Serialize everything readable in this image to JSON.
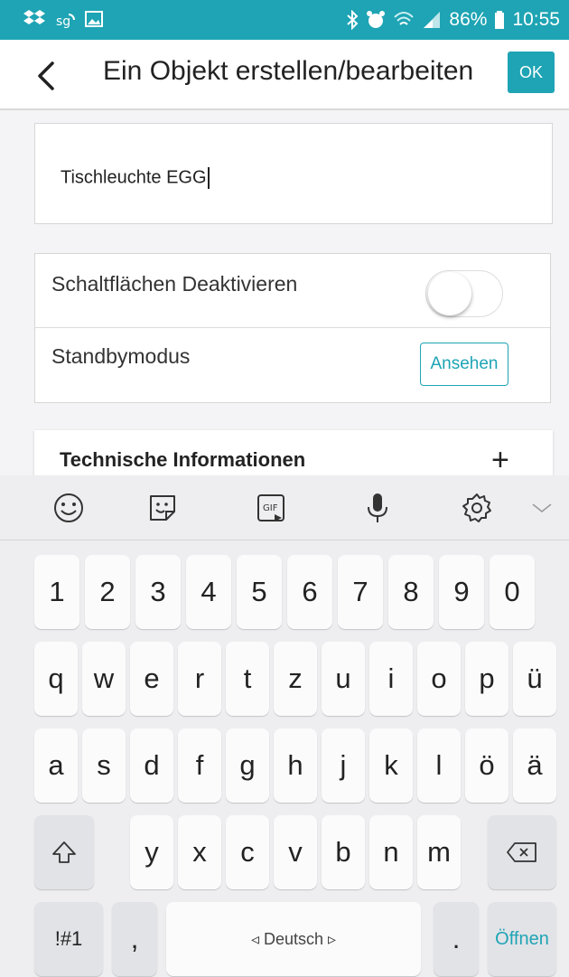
{
  "status_bar": {
    "battery": "86%",
    "time": "10:55",
    "left_icons": [
      "dropbox-icon",
      "sync-icon",
      "image-icon"
    ],
    "right_icons": [
      "bluetooth-icon",
      "alarm-icon",
      "wifi-icon",
      "signal-icon",
      "battery-icon"
    ]
  },
  "appbar": {
    "title": "Ein Objekt erstellen/bearbeiten",
    "ok_label": "OK"
  },
  "form": {
    "name_value": "Tischleuchte EGG",
    "disable_buttons_label": "Schaltflächen Deaktivieren",
    "disable_buttons_on": false,
    "standby_label": "Standbymodus",
    "standby_button": "Ansehen",
    "tech_info_title": "Technische Informationen",
    "tech_info_expand": "+"
  },
  "keyboard": {
    "toolbar": [
      "emoji-icon",
      "sticker-icon",
      "gif-icon",
      "microphone-icon",
      "settings-icon",
      "collapse-icon"
    ],
    "gif_label": "GIF",
    "row_numbers": [
      "1",
      "2",
      "3",
      "4",
      "5",
      "6",
      "7",
      "8",
      "9",
      "0"
    ],
    "row_q": [
      "q",
      "w",
      "e",
      "r",
      "t",
      "z",
      "u",
      "i",
      "o",
      "p",
      "ü"
    ],
    "row_a": [
      "a",
      "s",
      "d",
      "f",
      "g",
      "h",
      "j",
      "k",
      "l",
      "ö",
      "ä"
    ],
    "row_y": [
      "y",
      "x",
      "c",
      "v",
      "b",
      "n",
      "m"
    ],
    "symbols_label": "!#1",
    "comma_label": ",",
    "space_label": "◃ Deutsch ▹",
    "period_label": ".",
    "action_label": "Öffnen",
    "accent_color": "#1ea4b4"
  }
}
